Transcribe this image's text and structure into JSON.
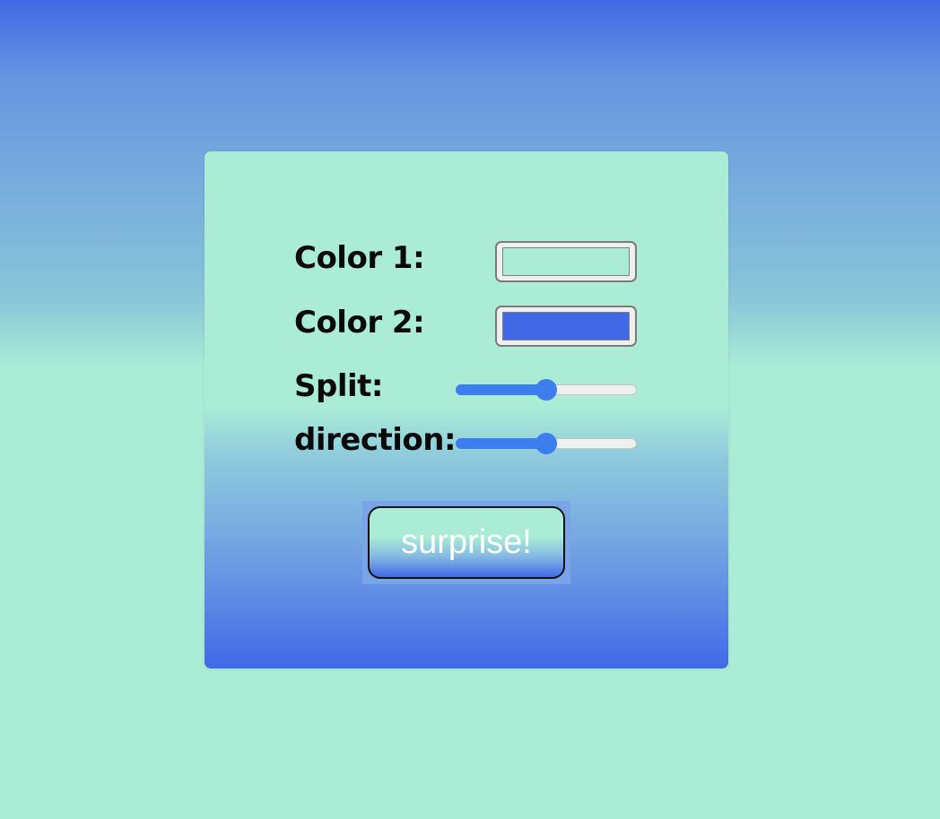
{
  "form": {
    "color1": {
      "label": "Color 1:",
      "value": "#aaecd6"
    },
    "color2": {
      "label": "Color 2:",
      "value": "#4169e6"
    },
    "split": {
      "label": "Split:",
      "value_percent": 50
    },
    "direction": {
      "label": "direction:",
      "value_percent": 50
    },
    "button_label": "surprise!"
  },
  "colors": {
    "accent": "#3c7df0",
    "mint": "#aaecd6",
    "royal_blue": "#4169e6"
  }
}
